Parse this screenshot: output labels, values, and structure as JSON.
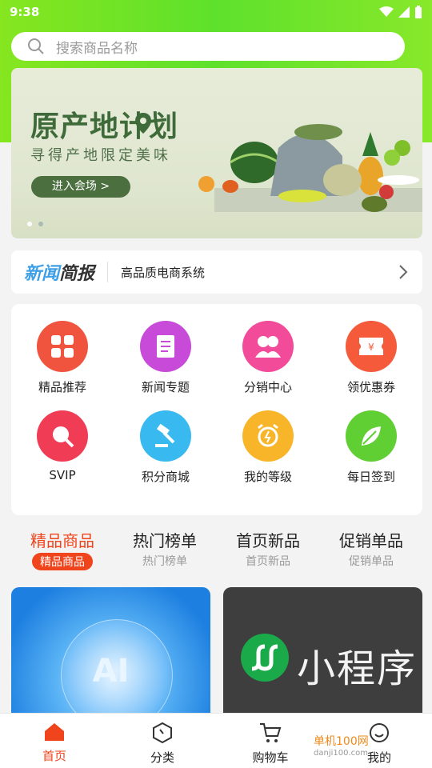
{
  "status_bar": {
    "time": "9:38"
  },
  "search": {
    "placeholder": "搜索商品名称"
  },
  "banner": {
    "title": "原产地计划",
    "subtitle": "寻得产地限定美味",
    "button": "进入会场 >"
  },
  "news": {
    "logo_a": "新闻",
    "logo_b": "简报",
    "text": "高品质电商系统"
  },
  "grid": [
    {
      "label": "精品推荐",
      "color": "#f0543e",
      "icon": "grid-icon"
    },
    {
      "label": "新闻专题",
      "color": "#c84ad8",
      "icon": "document-icon"
    },
    {
      "label": "分销中心",
      "color": "#f24b9a",
      "icon": "users-icon"
    },
    {
      "label": "领优惠券",
      "color": "#f55a3a",
      "icon": "coupon-icon"
    },
    {
      "label": "SVIP",
      "color": "#f03c55",
      "icon": "magnifier-icon"
    },
    {
      "label": "积分商城",
      "color": "#38b9ef",
      "icon": "gavel-icon"
    },
    {
      "label": "我的等级",
      "color": "#f8b52a",
      "icon": "alarm-clock-icon"
    },
    {
      "label": "每日签到",
      "color": "#5fcf33",
      "icon": "leaf-icon"
    }
  ],
  "tabs": [
    {
      "title": "精品商品",
      "sub": "精品商品",
      "active": true
    },
    {
      "title": "热门榜单",
      "sub": "热门榜单",
      "active": false
    },
    {
      "title": "首页新品",
      "sub": "首页新品",
      "active": false
    },
    {
      "title": "促销单品",
      "sub": "促销单品",
      "active": false
    }
  ],
  "products": [
    {
      "text": "AI"
    },
    {
      "text": "小程序"
    }
  ],
  "bottom_nav": [
    {
      "label": "首页",
      "icon": "home-icon",
      "active": true
    },
    {
      "label": "分类",
      "icon": "category-icon",
      "active": false
    },
    {
      "label": "购物车",
      "icon": "cart-icon",
      "active": false
    },
    {
      "label": "我的",
      "icon": "profile-icon",
      "active": false
    }
  ],
  "watermark": {
    "text": "单机100网",
    "sub": "danji100.com"
  },
  "colors": {
    "accent": "#f0441d",
    "header_green": "#6fe32a"
  }
}
